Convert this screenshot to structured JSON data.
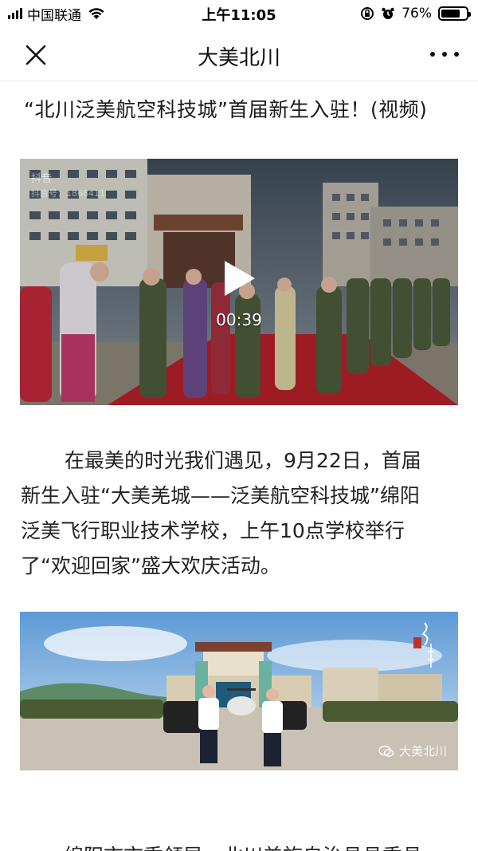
{
  "status_bar": {
    "carrier": "中国联通",
    "time": "上午11:05",
    "battery_percent": "76%",
    "battery_level": 0.76
  },
  "nav": {
    "title": "大美北川",
    "close_icon": "close-icon",
    "more_icon": "more-dots-icon"
  },
  "article": {
    "title": "“北川泛美航空科技城”首届新生入驻！(视频)",
    "video": {
      "duration": "00:39",
      "watermark_app": "抖音",
      "watermark_id": "抖音号：1868411"
    },
    "paragraph_lines": [
      "在最美的时光我们遇见，9月22日，首届",
      "新生入驻“大美羌城——泛美航空科技城”绵阳",
      "泛美飞行职业技术学校，上午10点学校举行",
      "了“欢迎回家”盛大欢庆活动。"
    ],
    "photo": {
      "watermark": "大美北川"
    },
    "next_line_partial": "绵阳市市委领导，北川羌族自治县县委县"
  },
  "colors": {
    "text": "#1a1a1a",
    "divider": "#e6e6e6",
    "carpet": "#b3202a"
  }
}
